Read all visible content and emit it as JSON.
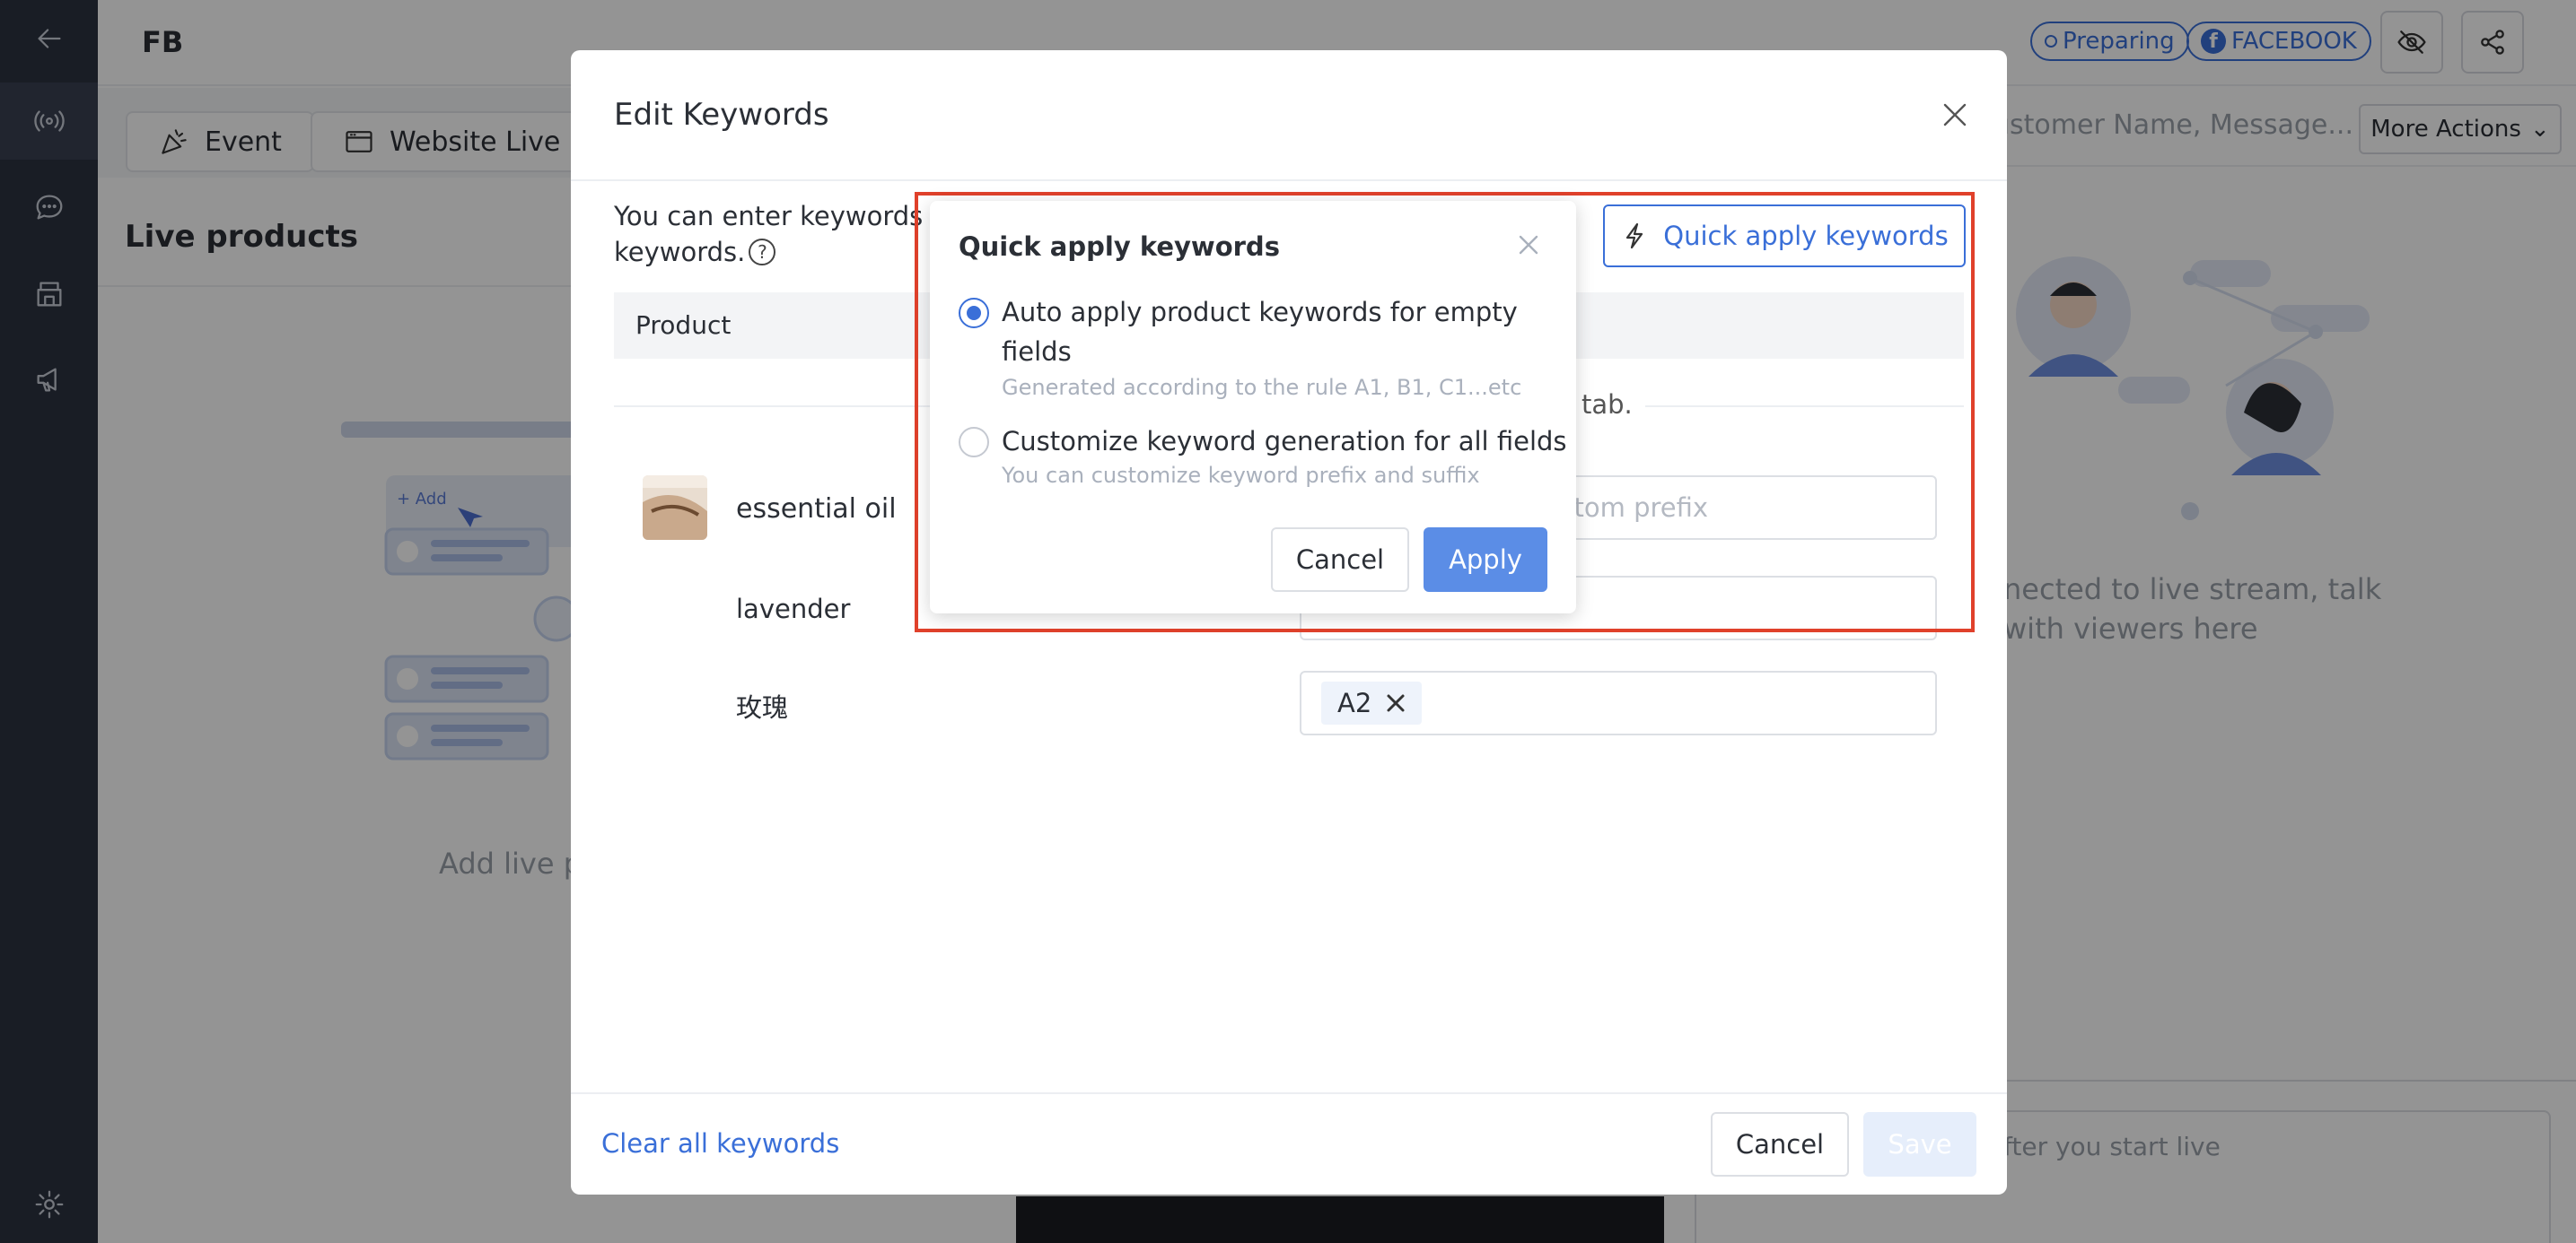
{
  "app": {
    "title": "FB",
    "status_preparing": "Preparing",
    "status_platform": "FACEBOOK"
  },
  "tabs": [
    {
      "label": "Event",
      "icon": "party-icon"
    },
    {
      "label": "Website Live",
      "icon": "browser-icon"
    }
  ],
  "left_panel": {
    "title": "Live products",
    "add_hint": "Add live p"
  },
  "illustration_add_label": "+ Add",
  "right_panel": {
    "search_placeholder": "ustomer Name, Message...",
    "more_actions": "More Actions",
    "message_line1": "nected to live stream, talk",
    "message_line2": "with viewers here",
    "input_placeholder": "fter you start live"
  },
  "modal": {
    "title": "Edit Keywords",
    "description_line1": "You can enter keywords m",
    "description_line2": "keywords.",
    "quick_apply_button": "Quick apply keywords",
    "table_header_product": "Product",
    "hint_tail": "tab.",
    "product": {
      "name": "essential oil",
      "prefix_placeholder": "ustom prefix",
      "variants": [
        {
          "name": "lavender",
          "keyword": ""
        },
        {
          "name": "玫瑰",
          "keyword": "A2"
        }
      ]
    },
    "footer": {
      "clear_all": "Clear all keywords",
      "cancel": "Cancel",
      "save": "Save"
    }
  },
  "popover": {
    "title": "Quick apply keywords",
    "options": [
      {
        "label_line1": "Auto apply product keywords for empty",
        "label_line2": "fields",
        "sub": "Generated according to the rule A1, B1, C1...etc",
        "checked": true
      },
      {
        "label_line1": "Customize keyword generation for all fields",
        "sub": "You can customize keyword prefix and suffix",
        "checked": false
      }
    ],
    "cancel": "Cancel",
    "apply": "Apply"
  },
  "colors": {
    "accent": "#3a6fd8",
    "sidebar": "#2c3240",
    "highlight": "#e0412b",
    "apply_bg": "#5b8de6"
  }
}
